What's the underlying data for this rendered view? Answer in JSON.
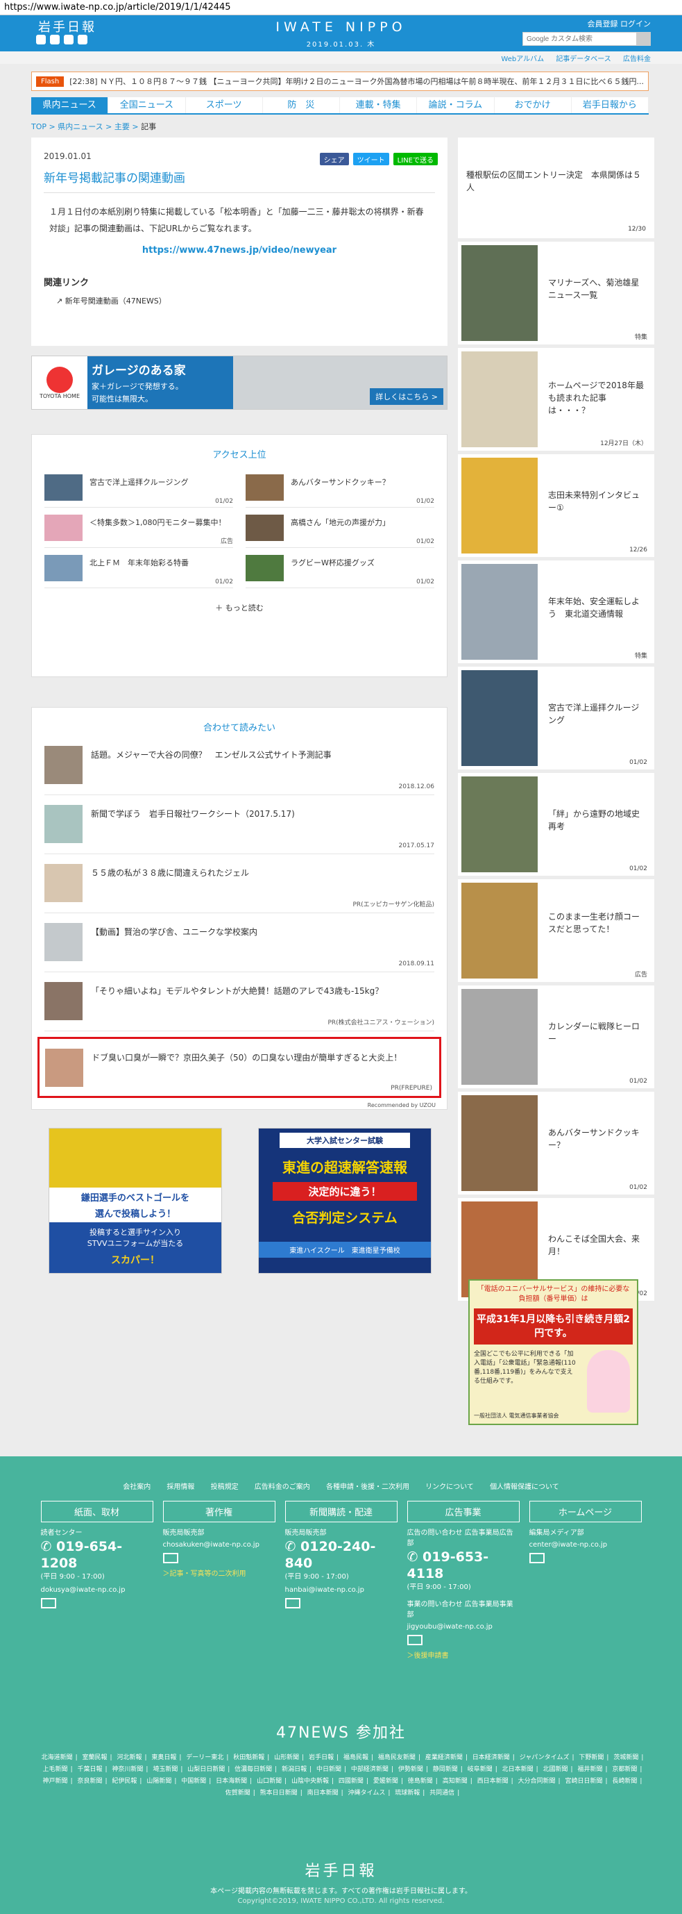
{
  "url": "https://www.iwate-np.co.jp/article/2019/1/1/42445",
  "header": {
    "logo": "岩手日報",
    "brand": "IWATE NIPPO",
    "date": "2019.01.03. 木",
    "member": "会員登録  ログイン",
    "search_placeholder": "Google カスタム検索"
  },
  "subnav": [
    "Webアルバム",
    "記事データベース",
    "広告料金"
  ],
  "flash": {
    "tag": "Flash",
    "text": "[22:38] ＮＹ円、１０８円８７～９７銭  【ニューヨーク共同】年明け２日のニューヨーク外国為替市場の円相場は午前８時半現在、前年１２月３１日に比べ６５銭円..."
  },
  "gnav": [
    "県内ニュース",
    "全国ニュース",
    "スポーツ",
    "防　災",
    "連載・特集",
    "論説・コラム",
    "おでかけ",
    "岩手日報から"
  ],
  "breadcrumb": {
    "top": "TOP",
    "pref": "県内ニュース",
    "main": "主要",
    "current": "記事"
  },
  "article": {
    "date": "2019.01.01",
    "share": [
      "シェア",
      "ツイート",
      "LINEで送る"
    ],
    "title": "新年号掲載記事の関連動画",
    "body": "１月１日付の本紙別刷り特集に掲載している「松本明香」と「加藤一二三・藤井聡太の将棋界・新春対談」記事の関連動画は、下記URLからご覧なれます。",
    "link": "https://www.47news.jp/video/newyear",
    "related_head": "関連リンク",
    "related": "新年号関連動画（47NEWS）"
  },
  "ad_top": {
    "title": "ガレージのある家",
    "line1": "家＋ガレージで発想する。",
    "line2": "可能性は無限大。",
    "logo": "TOYOTA HOME",
    "button": "詳しくはこちら >"
  },
  "ranking": {
    "title": "アクセス上位",
    "items": [
      {
        "text": "宮古で洋上遥拝クルージング",
        "date": "01/02"
      },
      {
        "text": "あんバターサンドクッキー？",
        "date": "01/02"
      },
      {
        "text": "＜特集多数＞1,080円モニター募集中！",
        "date": "広告"
      },
      {
        "text": "高橋さん「地元の声援が力」",
        "date": "01/02"
      },
      {
        "text": "北上ＦＭ　年末年始彩る特番",
        "date": "01/02"
      },
      {
        "text": "ラグビーW杯応援グッズ",
        "date": "01/02"
      }
    ],
    "more": "もっと読む"
  },
  "recs": {
    "title": "合わせて読みたい",
    "items": [
      {
        "text": "話題。メジャーで大谷の同僚？　エンゼルス公式サイト予測記事",
        "date": "2018.12.06"
      },
      {
        "text": "新聞で学ぼう　岩手日報社ワークシート（2017.5.17)",
        "date": "2017.05.17"
      },
      {
        "text": "５５歳の私が３８歳に間違えられたジェル",
        "date": "PR(エッピカーサゲン化粧品)"
      },
      {
        "text": "【動画】賢治の学び舎、ユニークな学校案内",
        "date": "2018.09.11"
      },
      {
        "text": "「そりゃ細いよね」モデルやタレントが大絶賛！話題のアレで43歳も-15kg？",
        "date": "PR(株式会社ユニアス・ウェーション)"
      },
      {
        "text": "ドブ臭い口臭が一瞬で？京田久美子（50）の口臭ない理由が簡単すぎると大炎上！",
        "date": "PR(FREPURE)"
      }
    ],
    "footer": "Recommended by  UZOU"
  },
  "ads_bottom": {
    "left": {
      "line1": "鎌田選手のベストゴールを",
      "line2": "選んで投稿しよう！",
      "line3": "投稿すると選手サイン入り",
      "line4": "STVVユニフォームが当たる",
      "brand": "スカパー！"
    },
    "right": {
      "head": "大学入試センター試験",
      "line1": "東進の超速解答速報",
      "line2": "決定的に違う！",
      "line3": "合否判定システム",
      "brand": "東進ハイスクール　東進衛星予備校"
    }
  },
  "sidebar": {
    "top": {
      "text": "種根駅伝の区間エントリー決定　本県関係は５人",
      "date": "12/30"
    },
    "items": [
      {
        "text": "マリナーズへ、菊池雄星ニュース一覧",
        "date": "特集"
      },
      {
        "text": "ホームページで2018年最も読まれた記事は・・・？",
        "date": "12月27日（木）"
      },
      {
        "text": "志田未来特別インタビュー①",
        "date": "12/26"
      },
      {
        "text": "年末年始、安全運転しよう　東北道交通情報",
        "date": "特集"
      },
      {
        "text": "宮古で洋上遥拝クルージング",
        "date": "01/02"
      },
      {
        "text": "「絆」から遠野の地域史再考",
        "date": "01/02"
      },
      {
        "text": "このまま一生老け顔コースだと思ってた！",
        "date": "広告"
      },
      {
        "text": "カレンダーに戦隊ヒーロー",
        "date": "01/02"
      },
      {
        "text": "あんバターサンドクッキー？",
        "date": "01/02"
      },
      {
        "text": "わんこそば全国大会、来月！",
        "date": "01/02"
      }
    ],
    "ad": {
      "top": "「電話のユニバーサルサービス」の維持に必要な負担額（番号単価）は",
      "big": "平成31年1月以降も引き続き月額2円です。",
      "small": "全国どこでも公平に利用できる「加入電話」「公衆電話」「緊急通報(110番,118番,119番)」をみんなで支える仕組みです。",
      "foot": "一般社団法人 電気通信事業者協会"
    }
  },
  "footer": {
    "links": [
      "会社案内",
      "採用情報",
      "投稿規定",
      "広告料金のご案内",
      "各種申請・後援・二次利用",
      "リンクについて",
      "個人情報保護について"
    ],
    "cols": [
      {
        "head": "紙面、取材",
        "l1": "読者センター",
        "tel": "019-654-1208",
        "hours": "(平日 9:00 - 17:00)",
        "mail": "dokusya@iwate-np.co.jp",
        "extra": ""
      },
      {
        "head": "著作権",
        "l1": "販売局販売部",
        "tel": "",
        "hours": "",
        "mail": "chosakuken@iwate-np.co.jp",
        "extra": "＞記事・写真等の二次利用"
      },
      {
        "head": "新聞購読・配達",
        "l1": "販売局販売部",
        "tel": "0120-240-840",
        "hours": "(平日 9:00 - 17:00)",
        "mail": "hanbai@iwate-np.co.jp",
        "extra": ""
      },
      {
        "head": "広告事業",
        "l1": "広告の問い合わせ 広告事業局広告部",
        "tel": "019-653-4118",
        "hours": "(平日 9:00 - 17:00)",
        "mail": "jigyoubu@iwate-np.co.jp",
        "extra": "＞後援申請書"
      },
      {
        "head": "ホームページ",
        "l1": "編集局メディア部",
        "tel": "",
        "hours": "",
        "mail": "center@iwate-np.co.jp",
        "extra": ""
      }
    ],
    "col4_extra": "事業の問い合わせ 広告事業局事業部",
    "news47": "47NEWS 参加社",
    "papers": [
      "北海道新聞",
      "室蘭民報",
      "河北新報",
      "東奥日報",
      "デーリー東北",
      "秋田魁新報",
      "山形新聞",
      "岩手日報",
      "福島民報",
      "福島民友新聞",
      "産業経済新聞",
      "日本経済新聞",
      "ジャパンタイムズ",
      "下野新聞",
      "茨城新聞",
      "上毛新聞",
      "千葉日報",
      "神奈川新聞",
      "埼玉新聞",
      "山梨日日新聞",
      "信濃毎日新聞",
      "新潟日報",
      "中日新聞",
      "中部経済新聞",
      "伊勢新聞",
      "静岡新聞",
      "岐阜新聞",
      "北日本新聞",
      "北國新聞",
      "福井新聞",
      "京都新聞",
      "神戸新聞",
      "奈良新聞",
      "紀伊民報",
      "山陽新聞",
      "中国新聞",
      "日本海新聞",
      "山口新聞",
      "山陰中央新報",
      "四國新聞",
      "愛媛新聞",
      "徳島新聞",
      "高知新聞",
      "西日本新聞",
      "大分合同新聞",
      "宮崎日日新聞",
      "長崎新聞",
      "佐賀新聞",
      "熊本日日新聞",
      "南日本新聞",
      "沖縄タイムス",
      "琉球新報",
      "共同通信"
    ],
    "logo": "岩手日報",
    "copy1": "本ページ掲載内容の無断転載を禁じます。すべての著作権は岩手日報社に属します。",
    "copy2": "Copyright©2019, IWATE NIPPO CO.,LTD. All rights reserved."
  }
}
